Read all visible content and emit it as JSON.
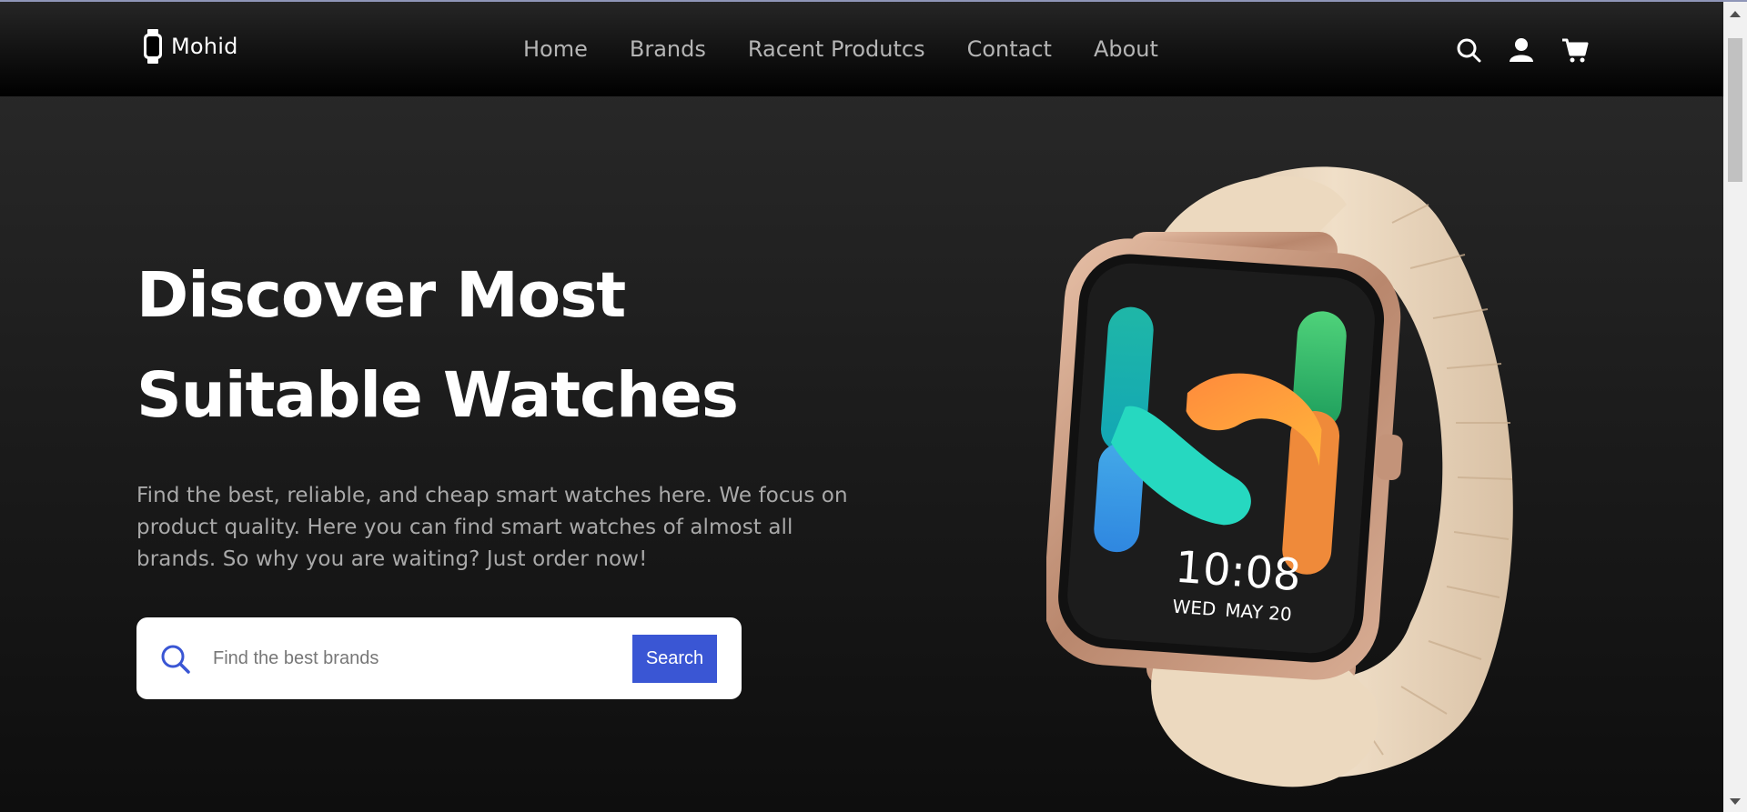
{
  "brand": {
    "name": "Mohid",
    "logo_icon": "watch-icon"
  },
  "nav": {
    "links": [
      "Home",
      "Brands",
      "Racent Produtcs",
      "Contact",
      "About"
    ],
    "icons": [
      "search-icon",
      "user-icon",
      "cart-icon"
    ]
  },
  "hero": {
    "title_line1": "Discover Most",
    "title_line2": "Suitable Watches",
    "description": "Find the best, reliable, and cheap smart watches here. We focus on product quality. Here you can find smart watches of almost all brands. So why you are waiting? Just order now!",
    "search_placeholder": "Find the best brands",
    "search_button": "Search"
  },
  "watch_display": {
    "time": "10:08",
    "day": "WED",
    "date": "MAY 20"
  },
  "colors": {
    "accent": "#3a56d4",
    "band": "#e9d5bd",
    "case": "#c99a82"
  }
}
